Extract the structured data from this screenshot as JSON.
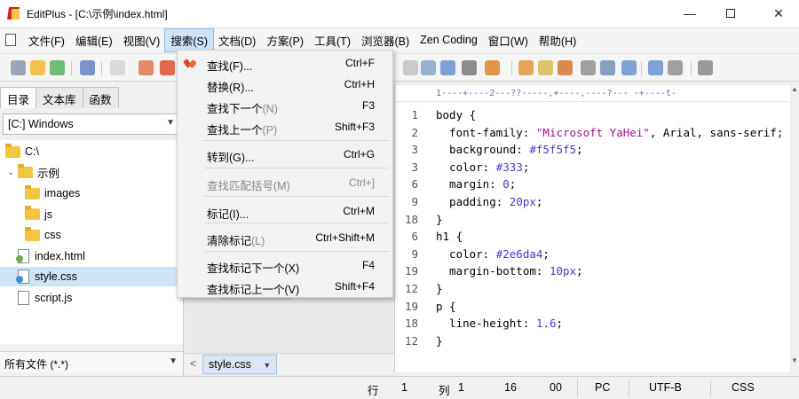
{
  "window": {
    "title": "EditPlus - [C:\\示例\\index.html]",
    "minimize_glyph": "—",
    "close_glyph": "✕"
  },
  "menubar": {
    "items": [
      "文件(F)",
      "编辑(E)",
      "视图(V)",
      "搜索(S)",
      "文档(D)",
      "方案(P)",
      "工具(T)",
      "浏览器(B)",
      "Zen Coding",
      "窗口(W)",
      "帮助(H)"
    ],
    "active": "搜索(S)"
  },
  "search_menu": {
    "items": [
      {
        "label": "查找(F)...",
        "hint": "",
        "shortcut": "Ctrl+F",
        "enabled": true
      },
      {
        "label": "替换(R)...",
        "hint": "",
        "shortcut": "Ctrl+H",
        "enabled": true
      },
      {
        "label": "查找下一个",
        "hint": "(N)",
        "shortcut": "F3",
        "enabled": true
      },
      {
        "label": "查找上一个",
        "hint": "(P)",
        "shortcut": "Shift+F3",
        "enabled": true
      },
      {
        "label": "转到(G)...",
        "hint": "",
        "shortcut": "Ctrl+G",
        "enabled": true
      },
      {
        "label": "查找匹配括号(M)",
        "hint": "",
        "shortcut": "Ctrl+]",
        "enabled": false
      },
      {
        "label": "标记(I)...",
        "hint": "",
        "shortcut": "Ctrl+M",
        "enabled": true
      },
      {
        "label": "清除标记",
        "hint": "(L)",
        "shortcut": "Ctrl+Shift+M",
        "enabled": true
      },
      {
        "label": "查找标记下一个(X)",
        "hint": "",
        "shortcut": "F4",
        "enabled": true
      },
      {
        "label": "查找标记上一个(V)",
        "hint": "",
        "shortcut": "Shift+F4",
        "enabled": true
      }
    ]
  },
  "left_panel": {
    "tabs": [
      "目录",
      "文本库",
      "函数"
    ],
    "active_tab": "目录",
    "drive": "[C:] Windows",
    "tree": [
      {
        "label": "C:\\",
        "type": "folder",
        "indent": 0,
        "caret": ""
      },
      {
        "label": "示例",
        "type": "folder",
        "indent": 1,
        "caret": "⌄"
      },
      {
        "label": "images",
        "type": "folder",
        "indent": 2,
        "caret": ""
      },
      {
        "label": "js",
        "type": "folder",
        "indent": 2,
        "caret": ""
      },
      {
        "label": "css",
        "type": "folder",
        "indent": 2,
        "caret": ""
      },
      {
        "label": "index.html",
        "type": "html",
        "indent": 1,
        "caret": ""
      },
      {
        "label": "style.css",
        "type": "css",
        "indent": 1,
        "caret": "",
        "selected": true
      },
      {
        "label": "script.js",
        "type": "js",
        "indent": 1,
        "caret": ""
      }
    ],
    "filter": "所有文件 (*.*)"
  },
  "document_tabs": {
    "scroll_left": "<",
    "active": "style.css"
  },
  "editor": {
    "ruler": "1----+----2---??-----,+----,----?--- -+----t-",
    "lines": [
      {
        "num": "1",
        "parts": [
          [
            "kw",
            "body {"
          ]
        ]
      },
      {
        "num": "2",
        "parts": [
          [
            "kw",
            "  font-family: "
          ],
          [
            "str",
            "\"Microsoft YaHei\""
          ],
          [
            "kw",
            ", Arial, sans-serif;"
          ]
        ]
      },
      {
        "num": "3",
        "parts": [
          [
            "kw",
            "  background: "
          ],
          [
            "num",
            "#f5f5f5"
          ],
          [
            "kw",
            ";"
          ]
        ]
      },
      {
        "num": "3",
        "parts": [
          [
            "kw",
            "  color: "
          ],
          [
            "num",
            "#333"
          ],
          [
            "kw",
            ";"
          ]
        ]
      },
      {
        "num": "6",
        "parts": [
          [
            "kw",
            "  margin: "
          ],
          [
            "num",
            "0"
          ],
          [
            "kw",
            ";"
          ]
        ]
      },
      {
        "num": "9",
        "parts": [
          [
            "kw",
            "  padding: "
          ],
          [
            "num",
            "20px"
          ],
          [
            "kw",
            ";"
          ]
        ]
      },
      {
        "num": "18",
        "parts": [
          [
            "kw",
            "}"
          ]
        ]
      },
      {
        "num": "6",
        "parts": [
          [
            "kw",
            "h1 {"
          ]
        ]
      },
      {
        "num": "9",
        "parts": [
          [
            "kw",
            "  color: "
          ],
          [
            "num",
            "#2e6da4"
          ],
          [
            "kw",
            ";"
          ]
        ]
      },
      {
        "num": "19",
        "parts": [
          [
            "kw",
            "  margin-bottom: "
          ],
          [
            "num",
            "10px"
          ],
          [
            "kw",
            ";"
          ]
        ]
      },
      {
        "num": "12",
        "parts": [
          [
            "kw",
            "}"
          ]
        ]
      },
      {
        "num": "19",
        "parts": [
          [
            "kw",
            "p {"
          ]
        ]
      },
      {
        "num": "18",
        "parts": [
          [
            "kw",
            "  line-height: "
          ],
          [
            "num",
            "1.6"
          ],
          [
            "kw",
            ";"
          ]
        ]
      },
      {
        "num": "12",
        "parts": [
          [
            "kw",
            "}"
          ]
        ]
      }
    ]
  },
  "statusbar": {
    "row_label": "行",
    "row_value": "1",
    "col_label": "列",
    "col_value": "1",
    "field3": "16",
    "field4": "00",
    "mode": "PC",
    "encoding": "UTF-B",
    "syntax": "CSS"
  },
  "colors": {
    "menu_active": "#cfe3f7",
    "css_string": "#a0148c",
    "css_value": "#4b36c9",
    "tree_selected": "#cde4f7"
  }
}
